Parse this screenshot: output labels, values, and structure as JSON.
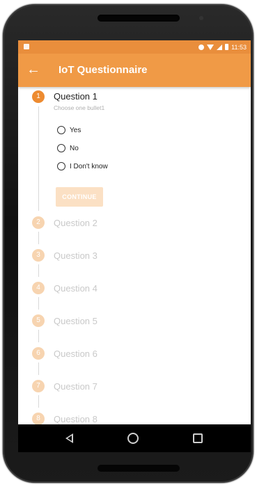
{
  "status_bar": {
    "time": "11:53",
    "icons": [
      "notification-icon",
      "circle-status-icon",
      "wifi-icon",
      "signal-icon",
      "battery-icon"
    ]
  },
  "app_bar": {
    "title": "IoT Questionnaire",
    "back_icon": "arrow-left-icon",
    "color": "#f09a46"
  },
  "stepper": {
    "active_color": "#ed8b30",
    "inactive_color": "#f7d4b0",
    "steps": [
      {
        "number": "1",
        "title": "Question 1",
        "subtitle": "Choose one bullet1",
        "active": true
      },
      {
        "number": "2",
        "title": "Question 2",
        "active": false
      },
      {
        "number": "3",
        "title": "Question 3",
        "active": false
      },
      {
        "number": "4",
        "title": "Question 4",
        "active": false
      },
      {
        "number": "5",
        "title": "Question 5",
        "active": false
      },
      {
        "number": "6",
        "title": "Question 6",
        "active": false
      },
      {
        "number": "7",
        "title": "Question 7",
        "active": false
      },
      {
        "number": "8",
        "title": "Question 8",
        "active": false
      }
    ],
    "options": [
      "Yes",
      "No",
      "I Don't know"
    ],
    "continue_label": "CONTINUE"
  },
  "nav_bar": {
    "icons": [
      "back-triangle-icon",
      "home-circle-icon",
      "recents-square-icon"
    ]
  }
}
